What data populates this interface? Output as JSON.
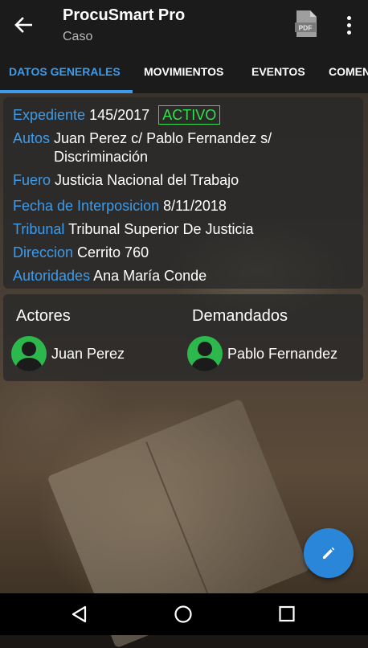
{
  "app": {
    "title": "ProcuSmart Pro",
    "subtitle": "Caso",
    "accent_color": "#3d9be9",
    "status_color": "#33e04b"
  },
  "toolbar": {
    "back_icon": "arrow-left-icon",
    "pdf_icon": "pdf-file-icon",
    "pdf_label": "PDF",
    "more_icon": "more-vertical-icon"
  },
  "tabs": [
    {
      "label": "DATOS GENERALES",
      "active": true
    },
    {
      "label": "MOVIMIENTOS",
      "active": false
    },
    {
      "label": "EVENTOS",
      "active": false
    },
    {
      "label": "COMENTARIOS",
      "active": false
    }
  ],
  "details": {
    "expediente": {
      "label": "Expediente",
      "value": "145/2017",
      "status": "ACTIVO"
    },
    "autos": {
      "label": "Autos",
      "value": "Juan Perez c/ Pablo Fernandez s/ Discriminación"
    },
    "fuero": {
      "label": "Fuero",
      "value": "Justicia Nacional del Trabajo"
    },
    "fecha": {
      "label": "Fecha de Interposicion",
      "value": "8/11/2018"
    },
    "tribunal": {
      "label": "Tribunal",
      "value": "Tribunal Superior De Justicia"
    },
    "direccion": {
      "label": "Direccion",
      "value": "Cerrito 760"
    },
    "autoridades": {
      "label": "Autoridades",
      "value": "Ana María Conde"
    }
  },
  "parties": {
    "actores_label": "Actores",
    "demandados_label": "Demandados",
    "actores": [
      {
        "name": "Juan Perez",
        "icon": "person-avatar-icon"
      }
    ],
    "demandados": [
      {
        "name": "Pablo Fernandez",
        "icon": "person-avatar-icon"
      }
    ]
  },
  "fab": {
    "icon": "pencil-edit-icon"
  },
  "navbar": {
    "back_icon": "nav-back-icon",
    "home_icon": "nav-home-icon",
    "recents_icon": "nav-recents-icon"
  }
}
